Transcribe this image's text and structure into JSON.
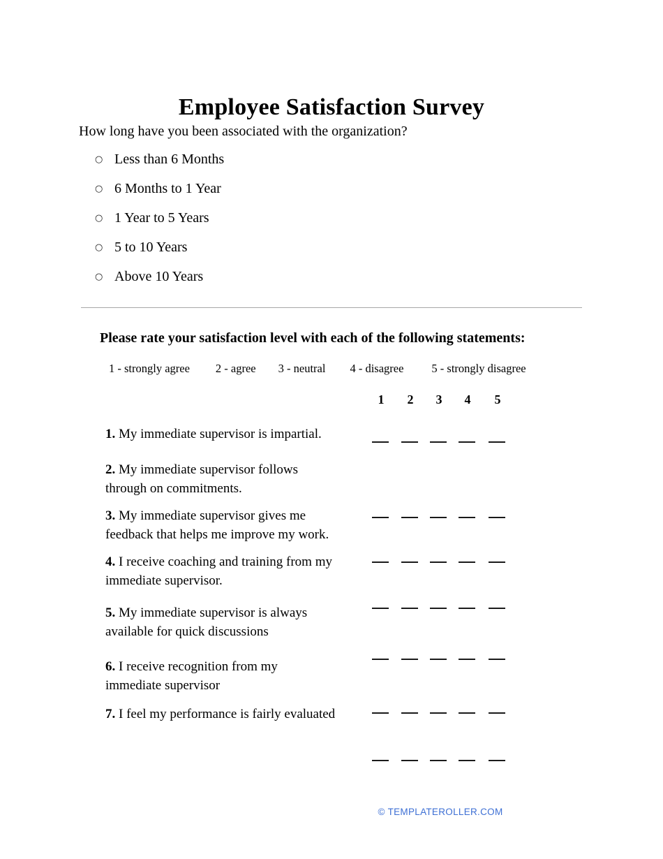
{
  "document": {
    "title": "Employee Satisfaction Survey"
  },
  "intro": {
    "question": "How long have you been associated with the organization?",
    "bullet_glyph": "○",
    "options": [
      {
        "label": "Less than 6 Months"
      },
      {
        "label": "6 Months to 1 Year"
      },
      {
        "label": "1 Year to 5 Years"
      },
      {
        "label": "5 to 10 Years"
      },
      {
        "label": "Above 10 Years"
      }
    ]
  },
  "rating_section": {
    "heading": "Please rate your satisfaction level with each of the following statements:",
    "legend": [
      {
        "label": "1 - strongly agree"
      },
      {
        "label": "2 - agree"
      },
      {
        "label": "3 - neutral"
      },
      {
        "label": "4 - disagree"
      },
      {
        "label": "5 -  strongly disagree"
      }
    ],
    "column_headers": [
      "1",
      "2",
      "3",
      "4",
      "5"
    ],
    "statements": [
      {
        "number": "1.",
        "text": "My immediate supervisor is impartial.",
        "lines": 1
      },
      {
        "number": "2.",
        "text": "My immediate supervisor follows through on commitments.",
        "lines": 2
      },
      {
        "number": "3.",
        "text": "My immediate supervisor gives me feedback that helps me improve my work.",
        "lines": 2
      },
      {
        "number": "4.",
        "text": "I receive coaching and training from my immediate supervisor.",
        "lines": 2
      },
      {
        "number": "5.",
        "text": "My immediate supervisor is always available for quick discussions",
        "lines": 2
      },
      {
        "number": "6.",
        "text": "I receive recognition from my immediate supervisor",
        "lines": 2
      },
      {
        "number": "7.",
        "text": "I feel my performance is fairly evaluated",
        "lines": 2
      }
    ]
  },
  "footer": {
    "copyright_symbol": "©",
    "site": "TEMPLATEROLLER.COM",
    "link_color": "#3d6fd4"
  }
}
